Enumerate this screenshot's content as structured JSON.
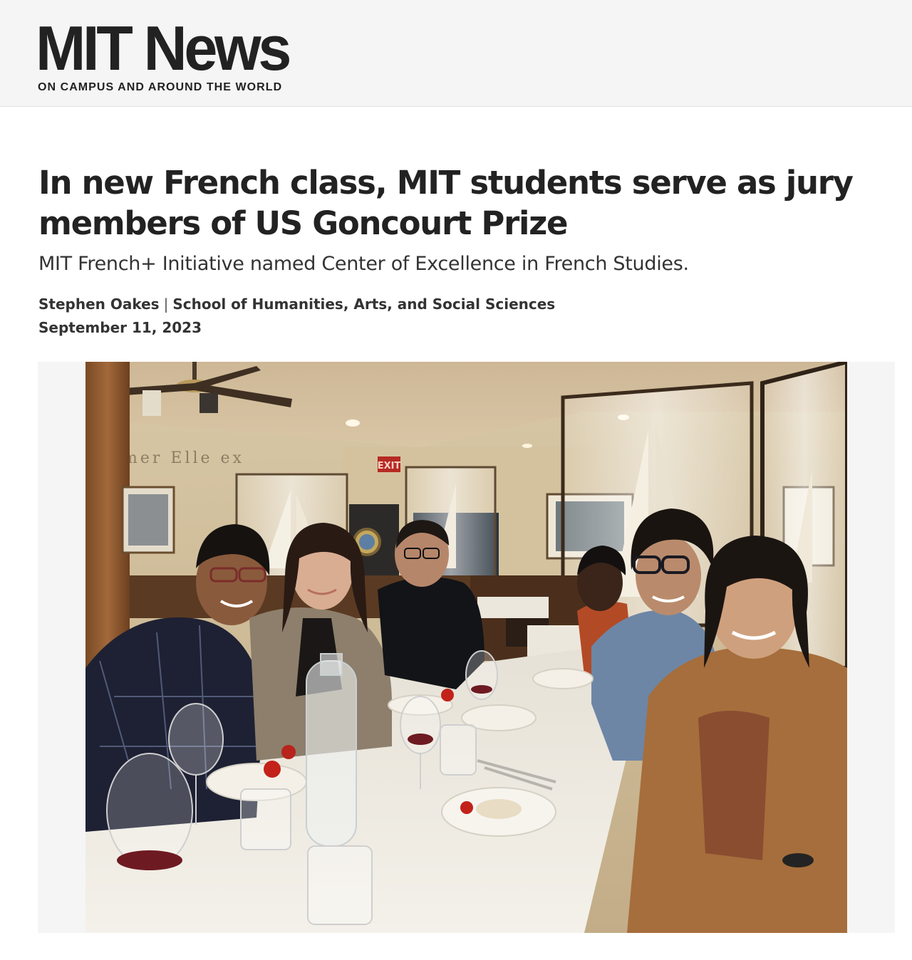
{
  "masthead": {
    "logo_title": "MIT News",
    "logo_tagline": "ON CAMPUS AND AROUND THE WORLD"
  },
  "article": {
    "headline": "In new French class, MIT students serve as jury members of US Goncourt Prize",
    "dek": "MIT French+ Initiative named Center of Excellence in French Studies.",
    "author": "Stephen Oakes",
    "byline_separator": "|",
    "department": "School of Humanities, Arts, and Social Sciences",
    "date": "September 11, 2023"
  },
  "photo": {
    "description_icon": "group-dinner-photo",
    "wall_lettering": "mer    Elle",
    "exit_sign": "EXIT"
  },
  "colors": {
    "masthead_bg": "#f5f5f5",
    "text": "#222222",
    "photo_frame_bg": "#f5f5f5"
  }
}
